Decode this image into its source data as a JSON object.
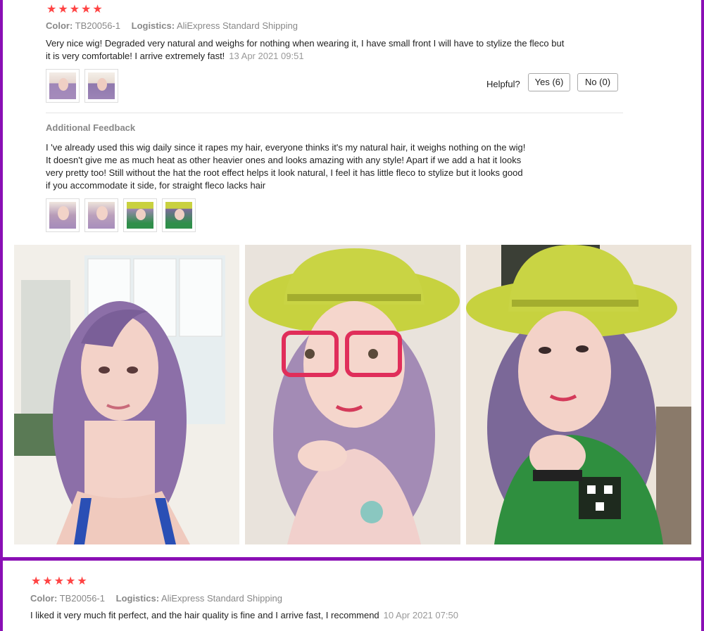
{
  "review1": {
    "rating": 5,
    "color_label": "Color:",
    "color_value": "TB20056-1",
    "logistics_label": "Logistics:",
    "logistics_value": "AliExpress Standard Shipping",
    "text": "Very nice wig! Degraded very natural and weighs for nothing when wearing it, I have small front I will have to stylize the fleco but it is very comfortable! I arrive extremely fast!",
    "date": "13 Apr 2021 09:51",
    "helpful_label": "Helpful?",
    "yes_label": "Yes (6)",
    "no_label": "No (0)",
    "additional_feedback_heading": "Additional Feedback",
    "additional_feedback_text": "I 've already used this wig daily since it rapes my hair, everyone thinks it's my natural hair, it weighs nothing on the wig! It doesn't give me as much heat as other heavier ones and looks amazing with any style! Apart if we add a hat it looks very pretty too! Still without the hat the root effect helps it look natural, I feel it has little fleco to stylize but it looks good if you accommodate it side, for straight fleco lacks hair"
  },
  "review2": {
    "rating": 5,
    "color_label": "Color:",
    "color_value": "TB20056-1",
    "logistics_label": "Logistics:",
    "logistics_value": "AliExpress Standard Shipping",
    "text": "I liked it very much fit perfect, and the hair quality is fine and I arrive fast, I recommend",
    "date": "10 Apr 2021 07:50"
  },
  "icons": {
    "star": "star-icon"
  },
  "colors": {
    "star": "#ff4444",
    "page_border": "#8a0fb5",
    "hair": "#8a6fa8",
    "hat": "#c5d23a"
  }
}
